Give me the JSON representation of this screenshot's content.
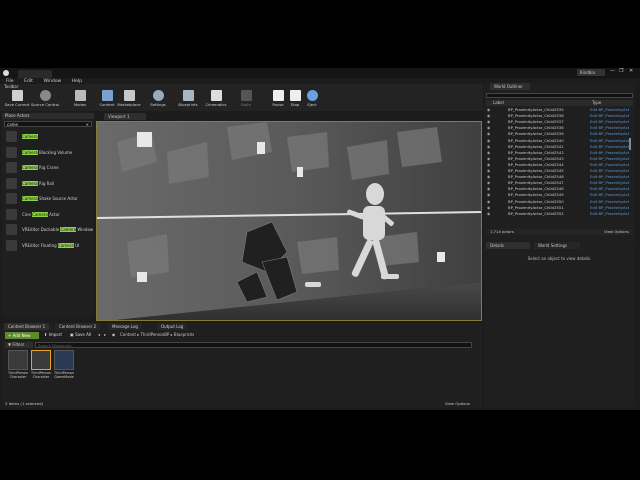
{
  "window": {
    "tab_title": "",
    "user_badge": "Kindbia",
    "controls": [
      "—",
      "❐",
      "✕"
    ]
  },
  "menu": [
    "File",
    "Edit",
    "Window",
    "Help"
  ],
  "toolbar": {
    "title": "Toolbar",
    "buttons": [
      {
        "label": "Save Current",
        "icon": "save-icon"
      },
      {
        "label": "Source Control",
        "icon": "source-control-icon"
      },
      {
        "label": "Modes",
        "icon": "modes-icon"
      },
      {
        "label": "Content",
        "icon": "content-icon"
      },
      {
        "label": "Marketplace",
        "icon": "marketplace-icon"
      },
      {
        "label": "Settings",
        "icon": "settings-icon"
      },
      {
        "label": "Blueprints",
        "icon": "blueprints-icon"
      },
      {
        "label": "Cinematics",
        "icon": "cinematics-icon"
      },
      {
        "label": "Build",
        "icon": "build-icon"
      },
      {
        "label": "Pause",
        "icon": "pause-icon"
      },
      {
        "label": "Stop",
        "icon": "stop-icon"
      },
      {
        "label": "Eject",
        "icon": "eject-icon"
      }
    ]
  },
  "place_actors": {
    "title": "Place Actors",
    "search_value": "came",
    "items": [
      {
        "pre": "",
        "match": "Camera",
        "post": ""
      },
      {
        "pre": "",
        "match": "Camera",
        "post": " Blocking Volume"
      },
      {
        "pre": "",
        "match": "Camera",
        "post": " Rig Crane"
      },
      {
        "pre": "",
        "match": "Camera",
        "post": " Rig Rail"
      },
      {
        "pre": "",
        "match": "Camera",
        "post": " Shake Source Actor"
      },
      {
        "pre": "Cine ",
        "match": "Camera",
        "post": " Actor"
      },
      {
        "pre": "VREditor Dockable ",
        "match": "Camera",
        "post": " Window"
      },
      {
        "pre": "VREditor Floating ",
        "match": "Camera",
        "post": " UI"
      }
    ]
  },
  "viewport": {
    "tab": "Viewport 1"
  },
  "world_outliner": {
    "title": "World Outliner",
    "col_label": "Label",
    "col_type": "Type",
    "rows": [
      {
        "label": "BP_ProximityActor_Child2535",
        "type": "Edit BP_ProximityAct"
      },
      {
        "label": "BP_ProximityActor_Child2536",
        "type": "Edit BP_ProximityAct"
      },
      {
        "label": "BP_ProximityActor_Child2537",
        "type": "Edit BP_ProximityAct"
      },
      {
        "label": "BP_ProximityActor_Child2538",
        "type": "Edit BP_ProximityAct"
      },
      {
        "label": "BP_ProximityActor_Child2539",
        "type": "Edit BP_ProximityAct"
      },
      {
        "label": "BP_ProximityActor_Child2540",
        "type": "Edit BP_ProximityAct"
      },
      {
        "label": "BP_ProximityActor_Child2541",
        "type": "Edit BP_ProximityAct"
      },
      {
        "label": "BP_ProximityActor_Child2542",
        "type": "Edit BP_ProximityAct"
      },
      {
        "label": "BP_ProximityActor_Child2543",
        "type": "Edit BP_ProximityAct"
      },
      {
        "label": "BP_ProximityActor_Child2544",
        "type": "Edit BP_ProximityAct"
      },
      {
        "label": "BP_ProximityActor_Child2545",
        "type": "Edit BP_ProximityAct"
      },
      {
        "label": "BP_ProximityActor_Child2546",
        "type": "Edit BP_ProximityAct"
      },
      {
        "label": "BP_ProximityActor_Child2547",
        "type": "Edit BP_ProximityAct"
      },
      {
        "label": "BP_ProximityActor_Child2548",
        "type": "Edit BP_ProximityAct"
      },
      {
        "label": "BP_ProximityActor_Child2549",
        "type": "Edit BP_ProximityAct"
      },
      {
        "label": "BP_ProximityActor_Child2550",
        "type": "Edit BP_ProximityAct"
      },
      {
        "label": "BP_ProximityActor_Child2551",
        "type": "Edit BP_ProximityAct"
      },
      {
        "label": "BP_ProximityActor_Child2552",
        "type": "Edit BP_ProximityAct"
      }
    ],
    "count": "1,714 actors",
    "view_options": "View Options"
  },
  "details": {
    "tab_details": "Details",
    "tab_world": "World Settings",
    "empty_text": "Select an object to view details."
  },
  "content_browser": {
    "tabs": [
      "Content Browser 1",
      "Content Browser 2",
      "Message Log",
      "Output Log"
    ],
    "add_new": "Add New",
    "import": "Import",
    "save_all": "Save All",
    "path": [
      "Content",
      "ThirdPersonBP",
      "Blueprints"
    ],
    "filters": "Filters",
    "search_placeholder": "Search Blueprints",
    "assets": [
      {
        "line1": "ThirdPerson",
        "line2": "Character"
      },
      {
        "line1": "ThirdPerson",
        "line2": "Character"
      },
      {
        "line1": "ThirdPerson",
        "line2": "GameMode"
      }
    ],
    "status": "3 items (1 selected)",
    "view_options": "View Options"
  },
  "colors": {
    "accent_green": "#8fd14a",
    "select_orange": "#e8a32a",
    "link_blue": "#5a9ad8",
    "panel_bg": "#1c1c1c"
  }
}
